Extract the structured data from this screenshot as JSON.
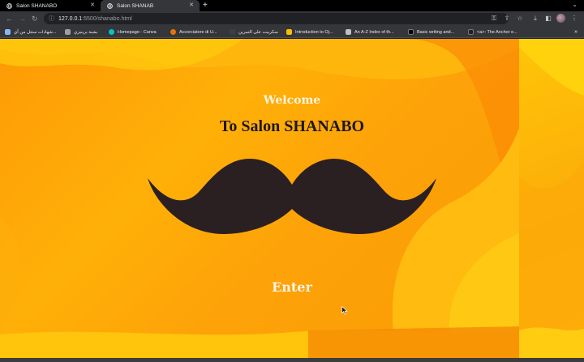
{
  "browser": {
    "tabs": [
      {
        "title": "Salon SHANABO",
        "active": false
      },
      {
        "title": "Salon SHANAB",
        "active": true
      }
    ],
    "url_host": "127.0.0.1",
    "url_path": ":5500/shanabo.html",
    "bookmarks": [
      {
        "label": "شهادات سجل من أي...",
        "color": "#8ab4f8"
      },
      {
        "label": "بشبة برينيزي",
        "color": "#9e9e9e"
      },
      {
        "label": "Homepage - Canva",
        "color": "#00c4cc"
      },
      {
        "label": "Accorciatore di U...",
        "color": "#e8710a"
      },
      {
        "label": "سكريبت على التمرين",
        "color": "#3c4043"
      },
      {
        "label": "Introduction to Oj...",
        "color": "#fbbc04"
      },
      {
        "label": "An A-Z Index of th...",
        "color": "#bdc1c6"
      },
      {
        "label": "Basic writing and...",
        "color": "#000000"
      },
      {
        "label": "<a>: The Anchor e...",
        "color": "#202124"
      }
    ],
    "bookmarks_more": "»"
  },
  "page": {
    "welcome": "Welcome",
    "title": "To Salon SHANABO",
    "enter": "Enter",
    "colors": {
      "background": "#fda209",
      "mustache": "#2b2021",
      "welcome_text": "#fff4df",
      "title_text": "#1d1715"
    }
  }
}
